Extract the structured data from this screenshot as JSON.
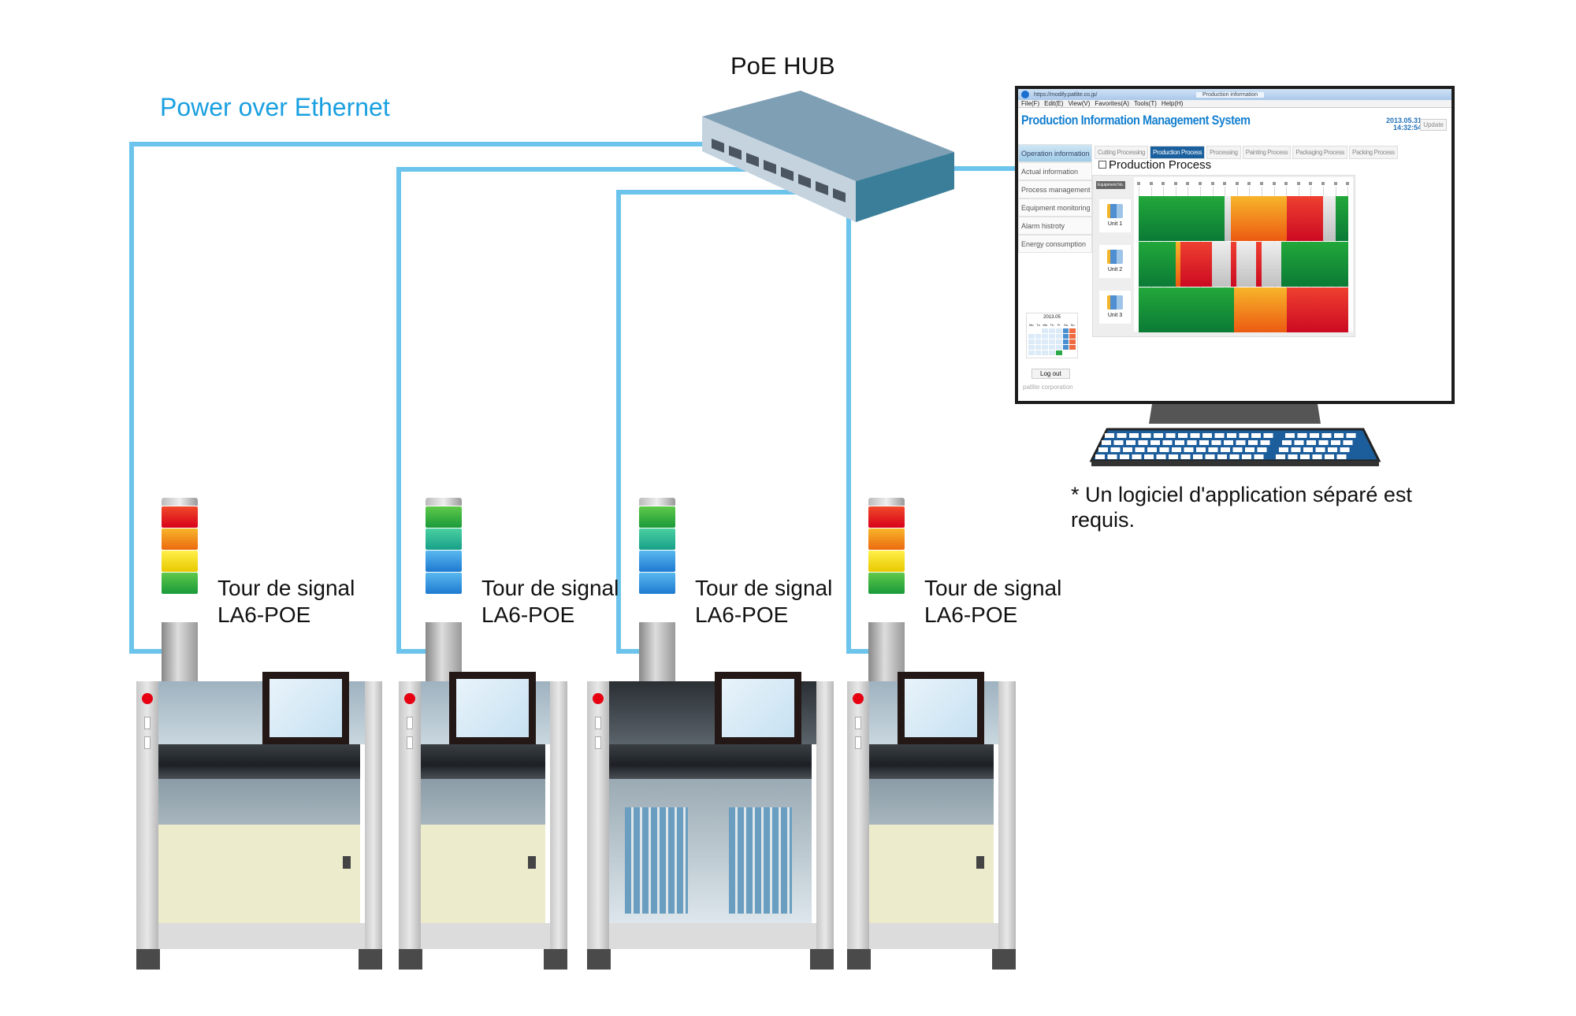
{
  "labels": {
    "poe": "Power over Ethernet",
    "hub": "PoE HUB",
    "note": "* Un logiciel d'application séparé est requis."
  },
  "colors": {
    "cable": "#6cc4ec",
    "poe_text": "#1aa0e0",
    "green": "#1a9a3a",
    "orange": "#f29a1a",
    "red": "#e0141e",
    "gray": "#cfcfcf"
  },
  "towers": [
    {
      "line1": "Tour de signal",
      "line2": "LA6-POE",
      "lamps": [
        "red",
        "orange",
        "yellow",
        "green"
      ]
    },
    {
      "line1": "Tour de signal",
      "line2": "LA6-POE",
      "lamps": [
        "green",
        "teal",
        "blue",
        "blue"
      ]
    },
    {
      "line1": "Tour de signal",
      "line2": "LA6-POE",
      "lamps": [
        "green",
        "teal",
        "blue",
        "blue"
      ]
    },
    {
      "line1": "Tour de signal",
      "line2": "LA6-POE",
      "lamps": [
        "red",
        "orange",
        "yellow",
        "green"
      ]
    }
  ],
  "app": {
    "url": "https://modify.patlite.co.jp/",
    "browser_tab": "Production information",
    "menu": [
      "File(F)",
      "Edit(E)",
      "View(V)",
      "Favorites(A)",
      "Tools(T)",
      "Help(H)"
    ],
    "title": "Production Information Management System",
    "date": "2013.05.31",
    "time": "14:32:54",
    "update": "Update",
    "sidebar": [
      {
        "label": "Operation information",
        "active": true
      },
      {
        "label": "Actual information"
      },
      {
        "label": "Process management"
      },
      {
        "label": "Equipment monitoring"
      },
      {
        "label": "Alarm histroty"
      },
      {
        "label": "Energy consumption"
      }
    ],
    "tabs": [
      {
        "label": "Cutting Processing"
      },
      {
        "label": "Production Process",
        "active": true
      },
      {
        "label": "Processing"
      },
      {
        "label": "Painting Process"
      },
      {
        "label": "Packaging Process"
      },
      {
        "label": "Packing Process"
      }
    ],
    "section_title": "Production Process",
    "equipment_header": "Equipment No.",
    "units": [
      {
        "name": "Unit 1",
        "segments": [
          [
            "green",
            0.41
          ],
          [
            "gray",
            0.03
          ],
          [
            "orange",
            0.265
          ],
          [
            "red",
            0.175
          ],
          [
            "gray",
            0.06
          ],
          [
            "green",
            0.06
          ]
        ]
      },
      {
        "name": "Unit 2",
        "segments": [
          [
            "green",
            0.175
          ],
          [
            "orange",
            0.025
          ],
          [
            "red",
            0.15
          ],
          [
            "gray",
            0.09
          ],
          [
            "red",
            0.025
          ],
          [
            "gray",
            0.095
          ],
          [
            "red",
            0.025
          ],
          [
            "gray",
            0.095
          ],
          [
            "green",
            0.32
          ]
        ]
      },
      {
        "name": "Unit 3",
        "segments": [
          [
            "green",
            0.455
          ],
          [
            "orange",
            0.25
          ],
          [
            "red",
            0.295
          ]
        ]
      }
    ],
    "calendar": {
      "month": "2013.05",
      "weekdays": [
        "Mo",
        "Tu",
        "We",
        "Th",
        "Fr",
        "Sa",
        "Su"
      ]
    },
    "logout": "Log out",
    "corp": "patlite corporation"
  }
}
